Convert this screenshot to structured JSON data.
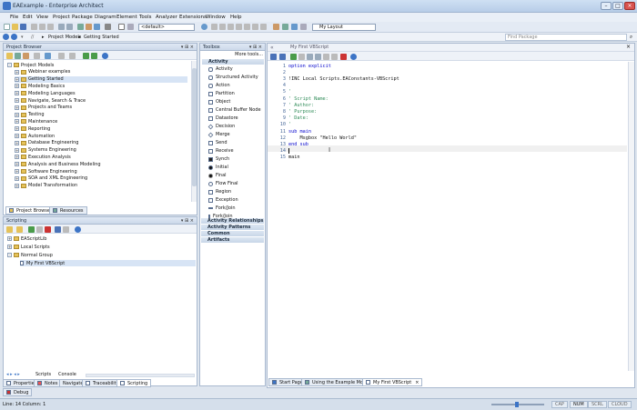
{
  "window": {
    "title": "EAExample - Enterprise Architect"
  },
  "menu": [
    "File",
    "Edit",
    "View",
    "Project",
    "Package",
    "Diagram",
    "Element",
    "Tools",
    "Analyzer",
    "Extensions",
    "Window",
    "Help"
  ],
  "toolbar": {
    "diagram_select": "<default>",
    "layout_select": "My Layout",
    "find_package": "Find Package"
  },
  "breadcrumb": {
    "root": "Project Models",
    "current": "Getting Started"
  },
  "project_browser": {
    "title": "Project Browser",
    "root": "Project Models",
    "items": [
      "Webinar examples",
      "Getting Started",
      "Modeling Basics",
      "Modeling Languages",
      "Navigate, Search & Trace",
      "Projects and Teams",
      "Testing",
      "Maintenance",
      "Reporting",
      "Automation",
      "Database Engineering",
      "Systems Engineering",
      "Execution Analysis",
      "Analysis and Business Modeling",
      "Software Engineering",
      "SOA and XML Engineering",
      "Model Transformation"
    ],
    "selected": "Getting Started",
    "tabs": [
      "Project Browser",
      "Resources"
    ]
  },
  "scripting": {
    "title": "Scripting",
    "items": [
      {
        "label": "EAScriptLib",
        "level": 0
      },
      {
        "label": "Local Scripts",
        "level": 0
      },
      {
        "label": "Normal Group",
        "level": 0
      },
      {
        "label": "My First VBScript",
        "level": 1
      }
    ],
    "bottom_tabs": [
      "Scripts",
      "Console"
    ],
    "selected": "My First VBScript"
  },
  "toolbox": {
    "title": "Toolbox",
    "more_tools": "More tools...",
    "activity_group": "Activity",
    "activity_items": [
      "Activity",
      "Structured Activity",
      "Action",
      "Partition",
      "Object",
      "Central Buffer Node",
      "Datastore",
      "Decision",
      "Merge",
      "Send",
      "Receive",
      "Synch",
      "Initial",
      "Final",
      "Flow Final",
      "Region",
      "Exception",
      "Fork/Join",
      "Fork/Join"
    ],
    "groups": [
      "Activity Relationships",
      "Activity Patterns",
      "Common",
      "Artifacts"
    ]
  },
  "editor": {
    "title": "My First VBScript",
    "lines": [
      {
        "n": "1",
        "text": "option explicit"
      },
      {
        "n": "2",
        "text": ""
      },
      {
        "n": "3",
        "text": "!INC Local Scripts.EAConstants-VBScript"
      },
      {
        "n": "4",
        "text": ""
      },
      {
        "n": "5",
        "text": "'"
      },
      {
        "n": "6",
        "text": "' Script Name:"
      },
      {
        "n": "7",
        "text": "' Author:"
      },
      {
        "n": "8",
        "text": "' Purpose:"
      },
      {
        "n": "9",
        "text": "' Date:"
      },
      {
        "n": "10",
        "text": "'"
      },
      {
        "n": "11",
        "text": "sub main"
      },
      {
        "n": "12",
        "text": "    Msgbox \"Hello World\""
      },
      {
        "n": "13",
        "text": "end sub"
      },
      {
        "n": "14",
        "text": ""
      },
      {
        "n": "15",
        "text": "main"
      }
    ],
    "tabs": [
      "Start Page",
      "Using the Example Model",
      "My First VBScript"
    ]
  },
  "bottom_dock_tabs": [
    "Properties",
    "Notes",
    "Navigate",
    "Traceability",
    "Scripting"
  ],
  "debug_tab": "Debug",
  "status": {
    "position": "Line: 14 Column: 1",
    "caps": "CAP",
    "num": "NUM",
    "scrl": "SCRL",
    "cloud": "CLOUD"
  },
  "colors": {
    "accent": "#3c74c6",
    "folder": "#e5c25a",
    "comment": "#2e8b57",
    "keyword": "#0000cc",
    "string": "#b22222"
  }
}
